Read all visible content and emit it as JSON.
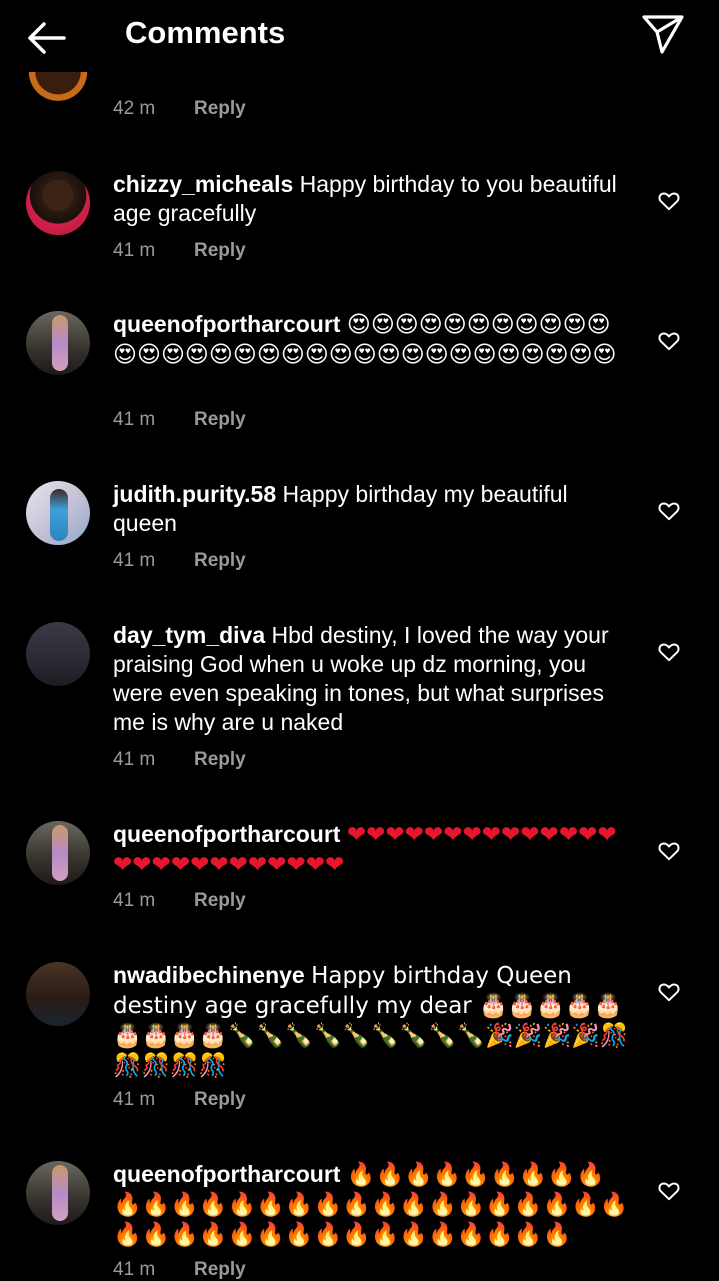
{
  "header": {
    "title": "Comments"
  },
  "reply_label": "Reply",
  "comments": [
    {
      "user": "",
      "text": "",
      "time": "42 m"
    },
    {
      "user": "chizzy_micheals",
      "text": "Happy birthday to you beautiful age gracefully",
      "time": "41 m"
    },
    {
      "user": "queenofportharcourt",
      "text": "😍😍😍😍😍😍😍😍😍😍😍😍😍😍😍😍😍😍😍😍😍😍😍😍😍😍😍😍😍😍😍😍",
      "time": "41 m"
    },
    {
      "user": "judith.purity.58",
      "text": "Happy birthday my beautiful queen",
      "time": "41 m"
    },
    {
      "user": "day_tym_diva",
      "text": "Hbd destiny, I loved the way your praising God when u woke up dz morning, you were even speaking in tones, but what surprises me is why are u naked",
      "time": "41 m"
    },
    {
      "user": "queenofportharcourt",
      "text": "❤❤❤❤❤❤❤❤❤❤❤❤❤❤❤❤❤❤❤❤❤❤❤❤❤❤",
      "time": "41 m"
    },
    {
      "user": "nwadibechinenye",
      "text": "Happy birthday Queen destiny age gracefully my dear 🎂🎂🎂🎂🎂🎂🎂🎂🎂🍾🍾🍾🍾🍾🍾🍾🍾🍾🎉🎉🎉🎉🎊🎊🎊🎊🎊",
      "time": "41 m"
    },
    {
      "user": "queenofportharcourt",
      "text": "🔥🔥🔥🔥🔥🔥🔥🔥🔥🔥🔥🔥🔥🔥🔥🔥🔥🔥🔥🔥🔥🔥🔥🔥🔥🔥🔥🔥🔥🔥🔥🔥🔥🔥🔥🔥🔥🔥🔥🔥🔥🔥🔥",
      "time": "41 m"
    }
  ],
  "colors": {
    "background": "#000000",
    "text": "#ffffff",
    "meta": "#9a9a9a"
  }
}
